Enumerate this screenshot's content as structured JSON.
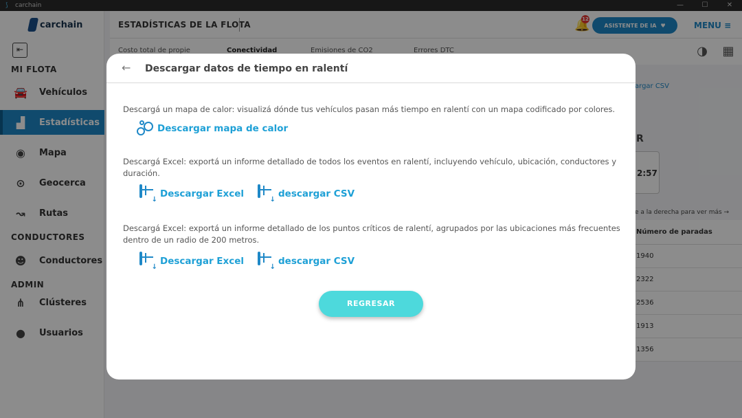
{
  "window": {
    "title": "carchain",
    "minimize": "—",
    "maximize": "☐",
    "close": "✕"
  },
  "sidebar": {
    "logo_text": "carchain",
    "sections": {
      "fleet": "MI FLOTA",
      "drivers": "CONDUCTORES",
      "admin": "ADMIN"
    },
    "items": [
      {
        "label": "Vehículos",
        "icon": "car-icon"
      },
      {
        "label": "Estadísticas",
        "icon": "bar-chart-icon"
      },
      {
        "label": "Mapa",
        "icon": "map-pin-icon"
      },
      {
        "label": "Geocerca",
        "icon": "geofence-icon"
      },
      {
        "label": "Rutas",
        "icon": "route-icon"
      },
      {
        "label": "Conductores",
        "icon": "driver-icon"
      },
      {
        "label": "Clústeres",
        "icon": "cluster-icon"
      },
      {
        "label": "Usuarios",
        "icon": "user-icon"
      }
    ]
  },
  "header": {
    "title": "ESTADÍSTICAS DE LA FLOTA",
    "notifications_count": "12",
    "ai_button": "ASISTENTE DE IA",
    "menu": "MENU"
  },
  "tabs": [
    {
      "label": "Costo total de propie"
    },
    {
      "label": "Conectividad"
    },
    {
      "label": "Emisiones de CO2"
    },
    {
      "label": "Errores DTC"
    }
  ],
  "background": {
    "csv_link": "argar CSV",
    "letter": "R",
    "time": "2:57",
    "scroll_hint": "e a la derecha para ver más →",
    "table_header": "Número de paradas",
    "rows": [
      "1940",
      "2322",
      "2536",
      "1913",
      "1356"
    ]
  },
  "modal": {
    "title": "Descargar datos de tiempo en ralentí",
    "section1": {
      "description": "Descargá un mapa de calor: visualizá dónde tus vehículos pasan más tiempo en ralentí con un mapa codificado por colores.",
      "link": "Descargar mapa de calor"
    },
    "section2": {
      "description": "Descargá Excel: exportá un informe detallado de todos los eventos en ralentí, incluyendo vehículo, ubicación, conductores y duración.",
      "excel": "Descargar Excel",
      "csv": "descargar CSV"
    },
    "section3": {
      "description": "Descargá Excel: exportá un informe detallado de los puntos críticos de ralentí, agrupados por las ubicaciones más frecuentes dentro de un radio de 200 metros.",
      "excel": "Descargar Excel",
      "csv": "descargar CSV"
    },
    "return_button": "REGRESAR"
  },
  "colors": {
    "accent": "#1e88c7",
    "link": "#1ea0d6",
    "return_button": "#4dd9dc"
  }
}
